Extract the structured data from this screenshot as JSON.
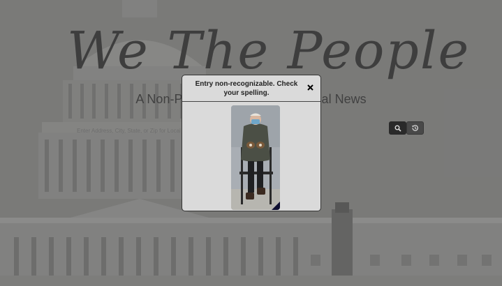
{
  "header": {
    "logo_text": "We The People",
    "subtitle": "A Non-Partisan Source for National News"
  },
  "search": {
    "placeholder": "Enter Address, City, State, or Zip for Local News",
    "search_icon": "search-icon",
    "history_icon": "history-icon"
  },
  "modal": {
    "title": "Entry non-recognizable. Check your spelling.",
    "close_icon": "close-icon",
    "image_subject": "seated man in parka, mask and mittens"
  },
  "colors": {
    "background_overlay": "#7a7a78",
    "title_text": "#2b2b2b",
    "modal_bg": "#dadada",
    "search_button": "#111111"
  }
}
